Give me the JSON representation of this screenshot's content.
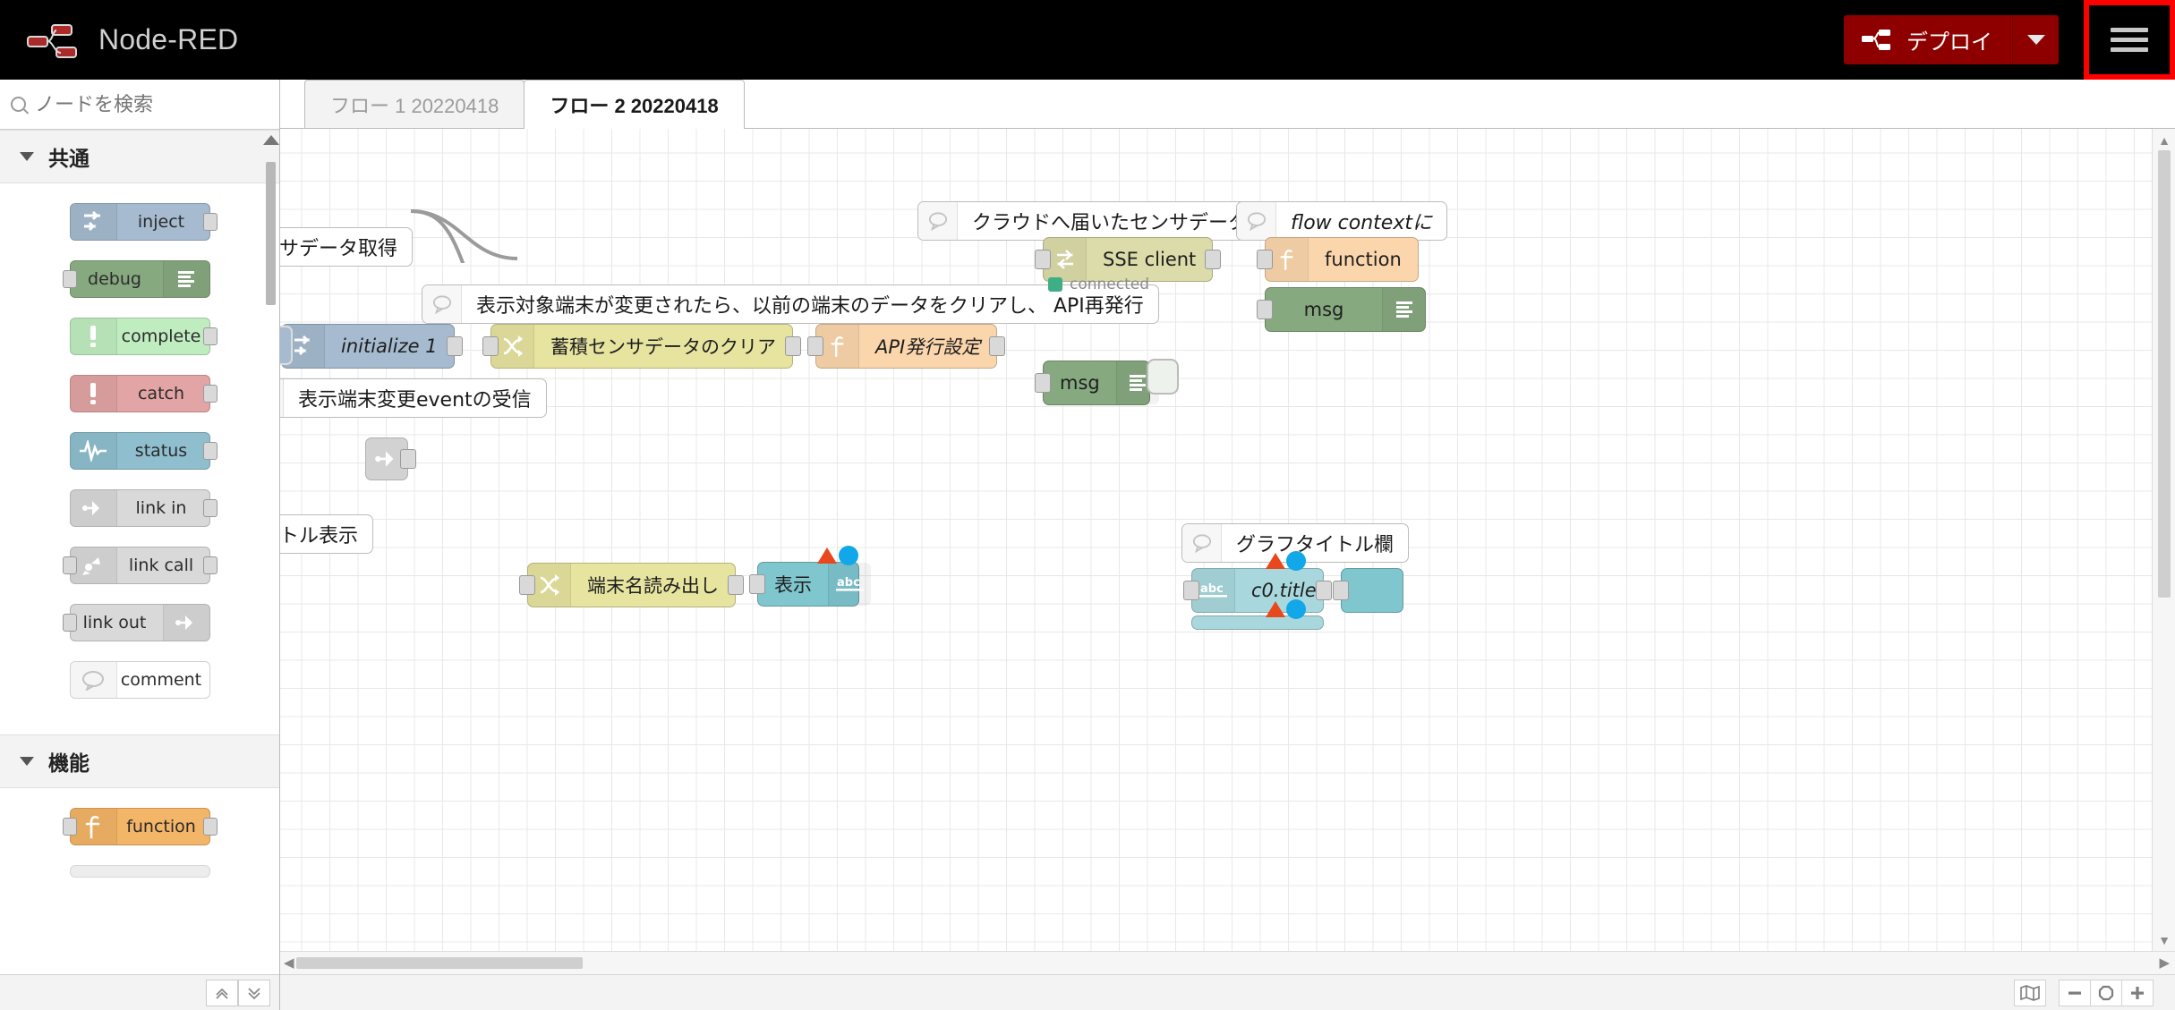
{
  "header": {
    "brand_title": "Node-RED",
    "brand_logo_icon": "node-red-logo-icon",
    "deploy_label": "デプロイ",
    "deploy_icon": "deploy-icon",
    "deploy_caret_icon": "chevron-down-icon",
    "menu_icon": "hamburger-menu-icon"
  },
  "palette": {
    "search_placeholder": "ノードを検索",
    "search_value": "",
    "search_icon": "search-icon",
    "categories": [
      {
        "label": "共通",
        "chevron_icon": "chevron-down-icon",
        "nodes": [
          {
            "label": "inject",
            "icon": "inject-arrow-icon",
            "color": "#a6bbcf",
            "icon_side": "left",
            "has_input": false,
            "has_output": true
          },
          {
            "label": "debug",
            "icon": "debug-lines-icon",
            "color": "#87a980",
            "icon_side": "right",
            "has_input": true,
            "has_output": false
          },
          {
            "label": "complete",
            "icon": "exclamation-icon",
            "color": "#c0edc0",
            "icon_side": "left",
            "has_input": false,
            "has_output": true
          },
          {
            "label": "catch",
            "icon": "exclamation-icon",
            "color": "#e2a4a4",
            "icon_side": "left",
            "has_input": false,
            "has_output": true
          },
          {
            "label": "status",
            "icon": "pulse-wave-icon",
            "color": "#8fbfcf",
            "icon_side": "left",
            "has_input": false,
            "has_output": true
          },
          {
            "label": "link in",
            "icon": "link-in-icon",
            "color": "#d9d9d9",
            "icon_side": "left",
            "has_input": false,
            "has_output": true
          },
          {
            "label": "link call",
            "icon": "link-call-icon",
            "color": "#d9d9d9",
            "icon_side": "left",
            "has_input": true,
            "has_output": true
          },
          {
            "label": "link out",
            "icon": "link-out-icon",
            "color": "#d9d9d9",
            "icon_side": "right",
            "has_input": true,
            "has_output": false
          },
          {
            "label": "comment",
            "icon": "comment-bubble-icon",
            "color": "#ffffff",
            "icon_side": "left",
            "has_input": false,
            "has_output": false
          }
        ]
      },
      {
        "label": "機能",
        "chevron_icon": "chevron-down-icon",
        "nodes": [
          {
            "label": "function",
            "icon": "function-f-icon",
            "color": "#f3b567",
            "icon_side": "left",
            "has_input": true,
            "has_output": true
          }
        ]
      }
    ],
    "footer": {
      "collapse_all_icon": "chevrons-up-icon",
      "expand_all_icon": "chevrons-down-icon"
    },
    "scroll_up_icon": "triangle-up-icon",
    "scroll_down_icon": "triangle-down-icon"
  },
  "tabs": [
    {
      "label": "フロー 1 20220418",
      "active": false
    },
    {
      "label": "フロー 2 20220418",
      "active": true
    }
  ],
  "canvas": {
    "comments": [
      {
        "text": "センサデータ取得",
        "icon": "comment-bubble-icon"
      },
      {
        "text": "表示対象端末が変更されたら、以前の端末のデータをクリアし、 API再発行",
        "icon": "comment-bubble-icon"
      },
      {
        "text": "表示端末変更eventの受信",
        "icon": "comment-bubble-icon"
      },
      {
        "text": "タイトル表示",
        "icon": "comment-bubble-icon"
      },
      {
        "text": "クラウドへ届いたセンサデータを取得",
        "icon": "comment-bubble-icon"
      },
      {
        "text": "flow contextに",
        "icon": "comment-bubble-icon"
      },
      {
        "text": "グラフタイトル欄",
        "icon": "comment-bubble-icon"
      }
    ],
    "nodes": [
      {
        "label": "initialize 1",
        "icon": "inject-arrow-icon",
        "color": "#a6bbcf",
        "type": "inject"
      },
      {
        "label": "蓄積センサデータのクリア",
        "icon": "change-swap-icon",
        "color": "#e7e4a0",
        "type": "change"
      },
      {
        "label": "API発行設定",
        "icon": "function-f-icon",
        "color": "#fbd6ac",
        "type": "function"
      },
      {
        "label": "SSE client",
        "icon": "sse-exchange-icon",
        "color": "#dcdcaa",
        "type": "sse",
        "status": "connected",
        "status_color": "#3fae85"
      },
      {
        "label": "function",
        "icon": "function-f-icon",
        "color": "#fbd6ac",
        "type": "function"
      },
      {
        "label": "msg",
        "icon": "debug-lines-icon",
        "color": "#87a980",
        "type": "debug"
      },
      {
        "label": "msg",
        "icon": "debug-lines-icon",
        "color": "#87a980",
        "type": "debug"
      },
      {
        "label": "端末名読み出し",
        "icon": "change-swap-icon",
        "color": "#e7e4a0",
        "type": "change"
      },
      {
        "label": "表示",
        "icon": "abc-text-icon",
        "color": "#7fc6cf",
        "type": "ui-text"
      },
      {
        "label": "c0.title",
        "icon": "abc-text-icon",
        "color": "#a8d8dd",
        "type": "ui-text"
      }
    ],
    "link_in_icon": "link-in-icon",
    "sse_status_text": "connected"
  },
  "statusbar": {
    "navigator_icon": "map-navigator-icon",
    "zoom_out_icon": "minus-icon",
    "zoom_reset_icon": "circle-icon",
    "zoom_in_icon": "plus-icon"
  }
}
